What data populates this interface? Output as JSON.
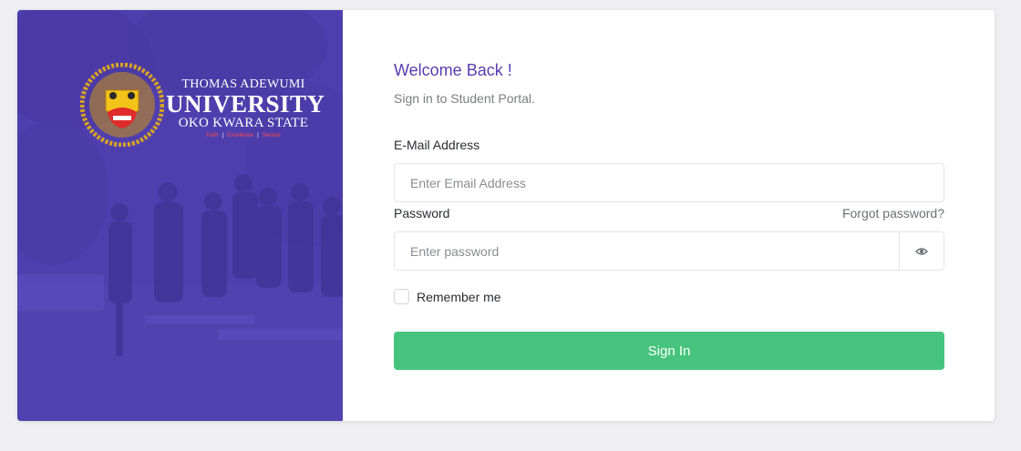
{
  "branding": {
    "line1": "THOMAS ADEWUMI",
    "line2": "UNIVERSITY",
    "line3": "OKO KWARA STATE",
    "motto": [
      "Faith",
      "Excellence",
      "Service"
    ]
  },
  "form": {
    "welcome": "Welcome Back !",
    "subtitle": "Sign in to Student Portal.",
    "email_label": "E-Mail Address",
    "email_placeholder": "Enter Email Address",
    "password_label": "Password",
    "forgot_label": "Forgot password?",
    "password_placeholder": "Enter password",
    "remember_label": "Remember me",
    "signin_label": "Sign In"
  },
  "colors": {
    "left_panel": "#4f3fae",
    "accent_text": "#5b3bb0",
    "signin_button": "#46c47e"
  },
  "icons": {
    "password_toggle": "eye-icon",
    "crest": "university-crest-icon"
  }
}
